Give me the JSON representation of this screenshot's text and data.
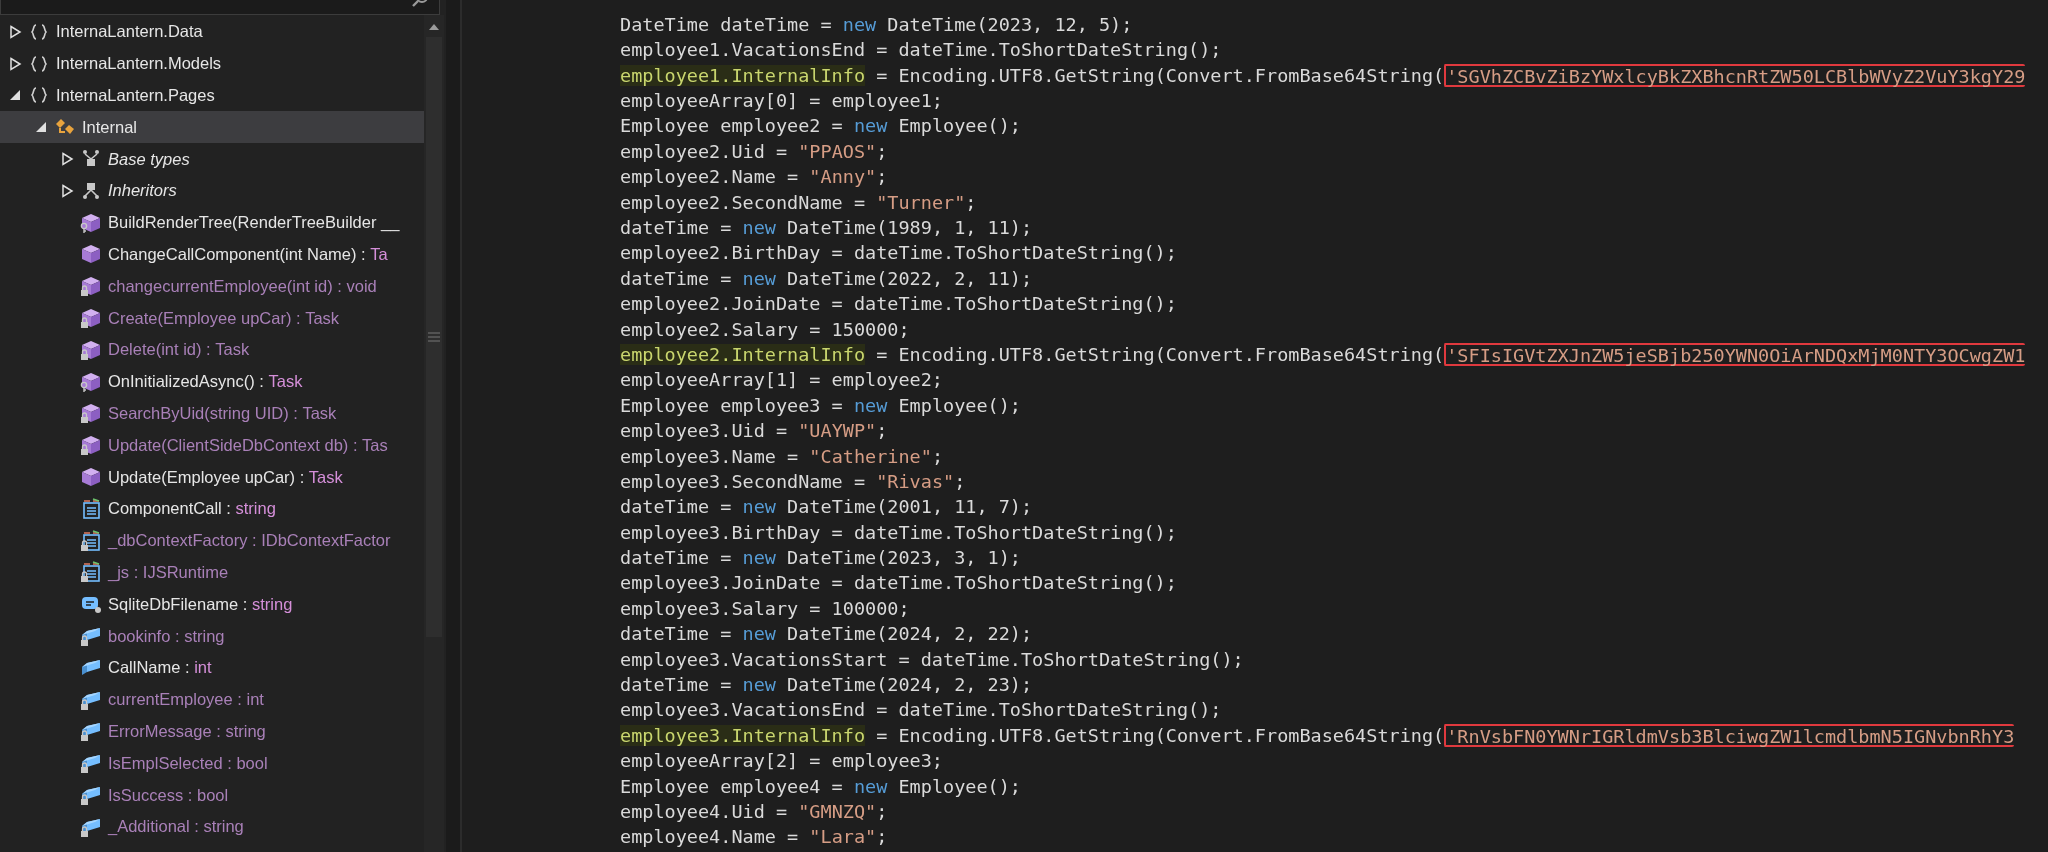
{
  "tree": [
    {
      "label": "InternaLantern.Data",
      "kind": "namespace",
      "expanded": false,
      "selected": false
    },
    {
      "label": "InternaLantern.Models",
      "kind": "namespace",
      "expanded": false,
      "selected": false
    },
    {
      "label": "InternaLantern.Pages",
      "kind": "namespace",
      "expanded": true,
      "selected": false,
      "children": [
        {
          "label": "Internal",
          "kind": "class",
          "expanded": true,
          "selected": true,
          "children": [
            {
              "label": "Base types",
              "kind": "basetypes",
              "expanded": false,
              "selected": false
            },
            {
              "label": "Inheritors",
              "kind": "inheritors",
              "expanded": false,
              "selected": false
            },
            {
              "label": "BuildRenderTree(RenderTreeBuilder __",
              "kind": "method",
              "private": false,
              "protected": true,
              "selected": false
            },
            {
              "label": "ChangeCallComponent(int Name) :",
              "type": "Ta",
              "kind": "method",
              "private": false,
              "protected": false,
              "selected": false
            },
            {
              "label": "changecurrentEmployee(int id) :",
              "type": "void",
              "kind": "method",
              "private": true,
              "protected": false,
              "selected": false
            },
            {
              "label": "Create(Employee upCar) :",
              "type": "Task",
              "kind": "method",
              "private": true,
              "protected": false,
              "selected": false
            },
            {
              "label": "Delete(int id) :",
              "type": "Task",
              "kind": "method",
              "private": true,
              "protected": false,
              "selected": false
            },
            {
              "label": "OnInitializedAsync() :",
              "type": "Task",
              "kind": "method",
              "private": false,
              "protected": true,
              "selected": false
            },
            {
              "label": "SearchByUid(string UID) :",
              "type": "Task",
              "kind": "method",
              "private": true,
              "protected": false,
              "selected": false
            },
            {
              "label": "Update(ClientSideDbContext db) :",
              "type": "Tas",
              "kind": "method",
              "private": true,
              "protected": false,
              "selected": false
            },
            {
              "label": "Update(Employee upCar) :",
              "type": "Task",
              "kind": "method",
              "private": false,
              "protected": false,
              "selected": false
            },
            {
              "label": "ComponentCall :",
              "type": "string",
              "kind": "property",
              "private": false,
              "protected": false,
              "selected": false
            },
            {
              "label": "_dbContextFactory :",
              "type": "IDbContextFactor",
              "kind": "property",
              "private": true,
              "protected": false,
              "selected": false
            },
            {
              "label": "_js :",
              "type": "IJSRuntime",
              "kind": "property",
              "private": true,
              "protected": false,
              "selected": false
            },
            {
              "label": "SqliteDbFilename :",
              "type": "string",
              "kind": "constant",
              "private": false,
              "protected": false,
              "selected": false
            },
            {
              "label": "bookinfo :",
              "type": "string",
              "kind": "field",
              "private": true,
              "protected": false,
              "selected": false
            },
            {
              "label": "CallName :",
              "type": "int",
              "kind": "field",
              "private": false,
              "protected": false,
              "selected": false
            },
            {
              "label": "currentEmployee :",
              "type": "int",
              "kind": "field",
              "private": true,
              "protected": false,
              "selected": false
            },
            {
              "label": "ErrorMessage :",
              "type": "string",
              "kind": "field",
              "private": true,
              "protected": false,
              "selected": false
            },
            {
              "label": "IsEmplSelected :",
              "type": "bool",
              "kind": "field",
              "private": true,
              "protected": false,
              "selected": false
            },
            {
              "label": "IsSuccess :",
              "type": "bool",
              "kind": "field",
              "private": true,
              "protected": false,
              "selected": false
            },
            {
              "label": "_Additional :",
              "type": "string",
              "kind": "field",
              "private": true,
              "protected": false,
              "selected": false
            }
          ]
        }
      ]
    }
  ],
  "code_lines": [
    [
      {
        "kind": "plain",
        "text": "DateTime dateTime = "
      },
      {
        "kind": "keyword",
        "text": "new"
      },
      {
        "kind": "plain",
        "text": " DateTime(2023, 12, 5);"
      }
    ],
    [
      {
        "kind": "plain",
        "text": "employee1.VacationsEnd = dateTime.ToShortDateString();"
      }
    ],
    [
      {
        "kind": "usage",
        "text": "employee1.InternalInfo"
      },
      {
        "kind": "plain",
        "text": " = Encoding.UTF8.GetString(Convert.FromBase64String("
      },
      {
        "kind": "boxed",
        "text": "'SGVhZCBvZiBzYWxlcyBkZXBhcnRtZW50LCBlbWVyZ2VuY3kgY29"
      }
    ],
    [
      {
        "kind": "plain",
        "text": "employeeArray[0] = employee1;"
      }
    ],
    [
      {
        "kind": "plain",
        "text": "Employee employee2 = "
      },
      {
        "kind": "keyword",
        "text": "new"
      },
      {
        "kind": "plain",
        "text": " Employee();"
      }
    ],
    [
      {
        "kind": "plain",
        "text": "employee2.Uid = "
      },
      {
        "kind": "string",
        "text": "\"PPAOS\""
      },
      {
        "kind": "plain",
        "text": ";"
      }
    ],
    [
      {
        "kind": "plain",
        "text": "employee2.Name = "
      },
      {
        "kind": "string",
        "text": "\"Anny\""
      },
      {
        "kind": "plain",
        "text": ";"
      }
    ],
    [
      {
        "kind": "plain",
        "text": "employee2.SecondName = "
      },
      {
        "kind": "string",
        "text": "\"Turner\""
      },
      {
        "kind": "plain",
        "text": ";"
      }
    ],
    [
      {
        "kind": "plain",
        "text": "dateTime = "
      },
      {
        "kind": "keyword",
        "text": "new"
      },
      {
        "kind": "plain",
        "text": " DateTime(1989, 1, 11);"
      }
    ],
    [
      {
        "kind": "plain",
        "text": "employee2.BirthDay = dateTime.ToShortDateString();"
      }
    ],
    [
      {
        "kind": "plain",
        "text": "dateTime = "
      },
      {
        "kind": "keyword",
        "text": "new"
      },
      {
        "kind": "plain",
        "text": " DateTime(2022, 2, 11);"
      }
    ],
    [
      {
        "kind": "plain",
        "text": "employee2.JoinDate = dateTime.ToShortDateString();"
      }
    ],
    [
      {
        "kind": "plain",
        "text": "employee2.Salary = 150000;"
      }
    ],
    [
      {
        "kind": "usage",
        "text": "employee2.InternalInfo"
      },
      {
        "kind": "plain",
        "text": " = Encoding.UTF8.GetString(Convert.FromBase64String("
      },
      {
        "kind": "boxed",
        "text": "'SFIsIGVtZXJnZW5jeSBjb250YWN0OiArNDQxMjM0NTY3OCwgZW1"
      }
    ],
    [
      {
        "kind": "plain",
        "text": "employeeArray[1] = employee2;"
      }
    ],
    [
      {
        "kind": "plain",
        "text": "Employee employee3 = "
      },
      {
        "kind": "keyword",
        "text": "new"
      },
      {
        "kind": "plain",
        "text": " Employee();"
      }
    ],
    [
      {
        "kind": "plain",
        "text": "employee3.Uid = "
      },
      {
        "kind": "string",
        "text": "\"UAYWP\""
      },
      {
        "kind": "plain",
        "text": ";"
      }
    ],
    [
      {
        "kind": "plain",
        "text": "employee3.Name = "
      },
      {
        "kind": "string",
        "text": "\"Catherine\""
      },
      {
        "kind": "plain",
        "text": ";"
      }
    ],
    [
      {
        "kind": "plain",
        "text": "employee3.SecondName = "
      },
      {
        "kind": "string",
        "text": "\"Rivas\""
      },
      {
        "kind": "plain",
        "text": ";"
      }
    ],
    [
      {
        "kind": "plain",
        "text": "dateTime = "
      },
      {
        "kind": "keyword",
        "text": "new"
      },
      {
        "kind": "plain",
        "text": " DateTime(2001, 11, 7);"
      }
    ],
    [
      {
        "kind": "plain",
        "text": "employee3.BirthDay = dateTime.ToShortDateString();"
      }
    ],
    [
      {
        "kind": "plain",
        "text": "dateTime = "
      },
      {
        "kind": "keyword",
        "text": "new"
      },
      {
        "kind": "plain",
        "text": " DateTime(2023, 3, 1);"
      }
    ],
    [
      {
        "kind": "plain",
        "text": "employee3.JoinDate = dateTime.ToShortDateString();"
      }
    ],
    [
      {
        "kind": "plain",
        "text": "employee3.Salary = 100000;"
      }
    ],
    [
      {
        "kind": "plain",
        "text": "dateTime = "
      },
      {
        "kind": "keyword",
        "text": "new"
      },
      {
        "kind": "plain",
        "text": " DateTime(2024, 2, 22);"
      }
    ],
    [
      {
        "kind": "plain",
        "text": "employee3.VacationsStart = dateTime.ToShortDateString();"
      }
    ],
    [
      {
        "kind": "plain",
        "text": "dateTime = "
      },
      {
        "kind": "keyword",
        "text": "new"
      },
      {
        "kind": "plain",
        "text": " DateTime(2024, 2, 23);"
      }
    ],
    [
      {
        "kind": "plain",
        "text": "employee3.VacationsEnd = dateTime.ToShortDateString();"
      }
    ],
    [
      {
        "kind": "usage",
        "text": "employee3.InternalInfo"
      },
      {
        "kind": "plain",
        "text": " = Encoding.UTF8.GetString(Convert.FromBase64String("
      },
      {
        "kind": "boxed",
        "text": "'RnVsbFN0YWNrIGRldmVsb3BlciwgZW1lcmdlbmN5IGNvbnRhY3"
      }
    ],
    [
      {
        "kind": "plain",
        "text": "employeeArray[2] = employee3;"
      }
    ],
    [
      {
        "kind": "plain",
        "text": "Employee employee4 = "
      },
      {
        "kind": "keyword",
        "text": "new"
      },
      {
        "kind": "plain",
        "text": " Employee();"
      }
    ],
    [
      {
        "kind": "plain",
        "text": "employee4.Uid = "
      },
      {
        "kind": "string",
        "text": "\"GMNZQ\""
      },
      {
        "kind": "plain",
        "text": ";"
      }
    ],
    [
      {
        "kind": "plain",
        "text": "employee4.Name = "
      },
      {
        "kind": "string",
        "text": "\"Lara\""
      },
      {
        "kind": "plain",
        "text": ";"
      }
    ]
  ]
}
